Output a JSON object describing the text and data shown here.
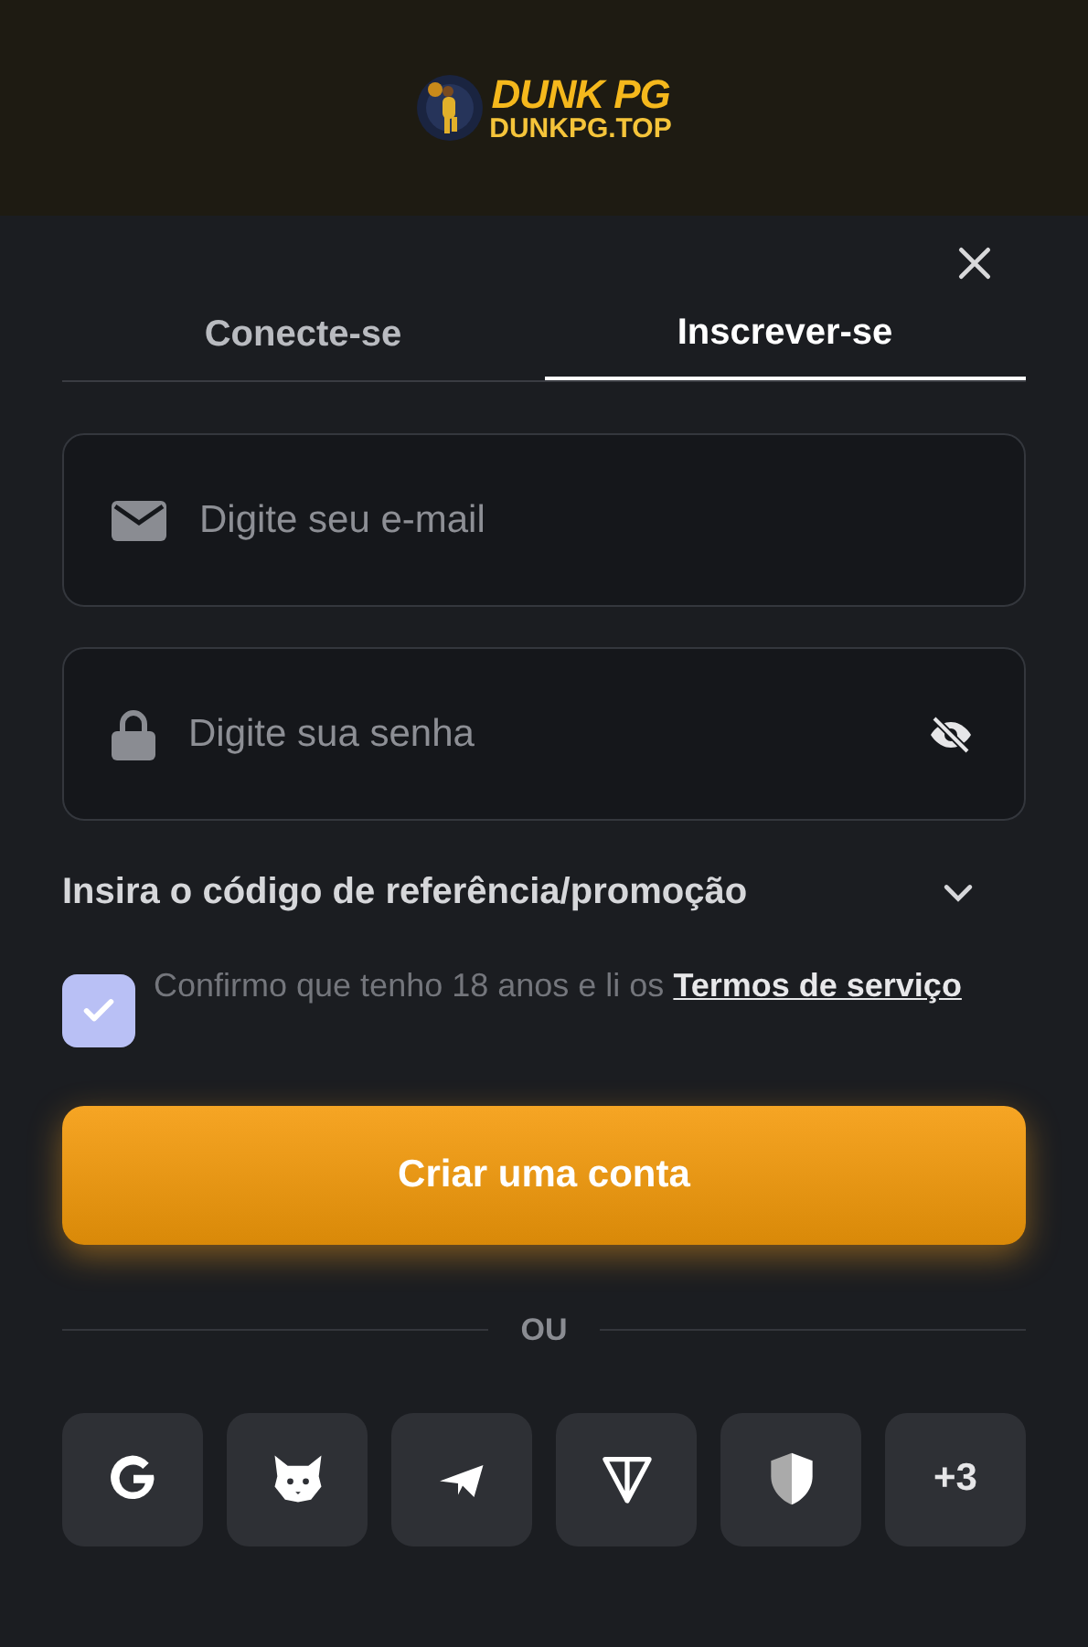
{
  "logo": {
    "title": "DUNK PG",
    "subtitle": "DUNKPG.TOP"
  },
  "tabs": [
    {
      "label": "Conecte-se",
      "selected": false
    },
    {
      "label": "Inscrever-se",
      "selected": true
    }
  ],
  "fields": [
    {
      "kind": "email",
      "placeholder": "Digite seu e-mail"
    },
    {
      "kind": "password",
      "placeholder": "Digite sua senha"
    }
  ],
  "promo": {
    "label": "Insira o código de referência/promoção",
    "expanded": false
  },
  "terms": {
    "checked": true,
    "text": "Confirmo que tenho 18 anos e li os",
    "link": "Termos de serviço"
  },
  "submit": "Criar uma conta",
  "divider": "OU",
  "social": [
    {
      "kind": "google"
    },
    {
      "kind": "fox"
    },
    {
      "kind": "telegram"
    },
    {
      "kind": "ton"
    },
    {
      "kind": "shield"
    },
    {
      "kind": "more",
      "label": "+3"
    }
  ]
}
